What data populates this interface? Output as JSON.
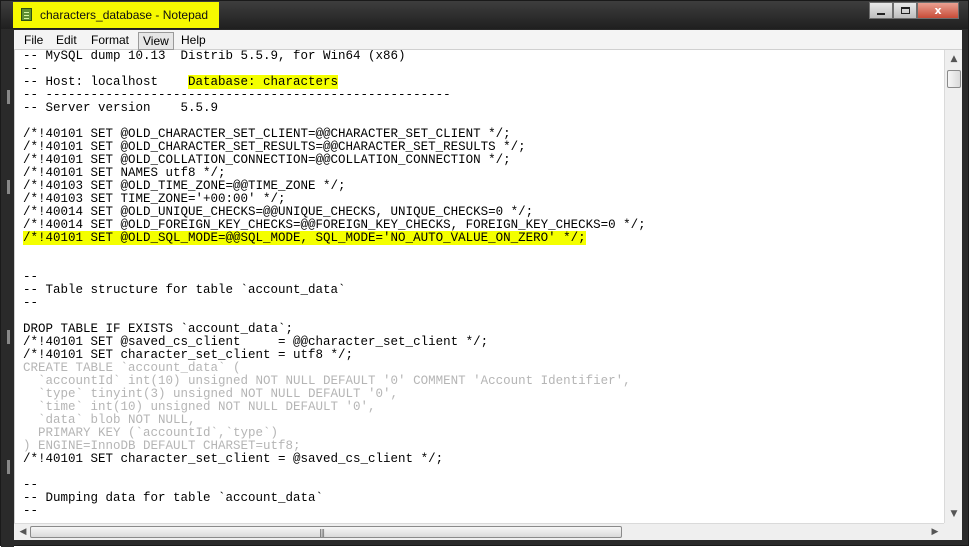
{
  "window": {
    "title": "characters_database - Notepad",
    "icon": "notepad-icon",
    "controls": {
      "close_label": "x"
    }
  },
  "menu": [
    "File",
    "Edit",
    "Format",
    "View",
    "Help"
  ],
  "active_menu": "View",
  "highlight_color": "#f4ff00",
  "document": {
    "lines": [
      "-- MySQL dump 10.13  Distrib 5.5.9, for Win64 (x86)",
      "--",
      "-- Host: localhost    Database: characters",
      "-- ------------------------------------------------------",
      "-- Server version    5.5.9",
      "",
      "/*!40101 SET @OLD_CHARACTER_SET_CLIENT=@@CHARACTER_SET_CLIENT */;",
      "/*!40101 SET @OLD_CHARACTER_SET_RESULTS=@@CHARACTER_SET_RESULTS */;",
      "/*!40101 SET @OLD_COLLATION_CONNECTION=@@COLLATION_CONNECTION */;",
      "/*!40101 SET NAMES utf8 */;",
      "/*!40103 SET @OLD_TIME_ZONE=@@TIME_ZONE */;",
      "/*!40103 SET TIME_ZONE='+00:00' */;",
      "/*!40014 SET @OLD_UNIQUE_CHECKS=@@UNIQUE_CHECKS, UNIQUE_CHECKS=0 */;",
      "/*!40014 SET @OLD_FOREIGN_KEY_CHECKS=@@FOREIGN_KEY_CHECKS, FOREIGN_KEY_CHECKS=0 */;",
      "/*!40101 SET @OLD_SQL_MODE=@@SQL_MODE, SQL_MODE='NO_AUTO_VALUE_ON_ZERO' */;",
      "",
      "",
      "--",
      "-- Table structure for table `account_data`",
      "--",
      "",
      "DROP TABLE IF EXISTS `account_data`;",
      "/*!40101 SET @saved_cs_client     = @@character_set_client */;",
      "/*!40101 SET character_set_client = utf8 */;",
      "CREATE TABLE `account_data` (",
      "  `accountId` int(10) unsigned NOT NULL DEFAULT '0' COMMENT 'Account Identifier',",
      "  `type` tinyint(3) unsigned NOT NULL DEFAULT '0',",
      "  `time` int(10) unsigned NOT NULL DEFAULT '0',",
      "  `data` blob NOT NULL,",
      "  PRIMARY KEY (`accountId`,`type`)",
      ") ENGINE=InnoDB DEFAULT CHARSET=utf8;",
      "/*!40101 SET character_set_client = @saved_cs_client */;",
      "",
      "--",
      "-- Dumping data for table `account_data`",
      "--"
    ],
    "highlighted_line_index": 14,
    "highlighted_text": "Database: characters",
    "faint_line_indexes": [
      24,
      25,
      26,
      27,
      28,
      29,
      30
    ]
  }
}
